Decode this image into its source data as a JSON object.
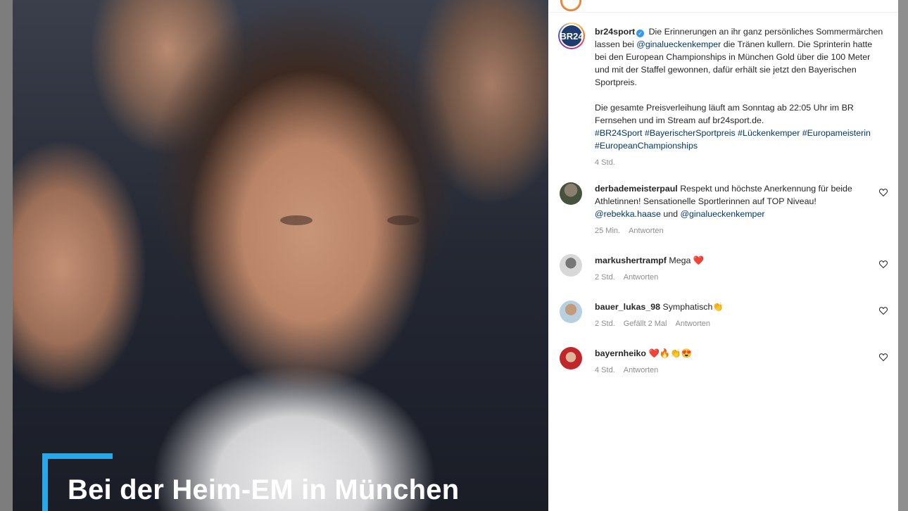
{
  "media": {
    "caption": "Bei der Heim-EM in München",
    "accent_color": "#28a8e8"
  },
  "post": {
    "avatar_logo": "BR24",
    "username": "br24sport",
    "verified_icon": "verified-badge-icon",
    "caption_parts": {
      "p1": "Die Erinnerungen an ihr ganz persönliches Sommermärchen lassen bei ",
      "mention": "@ginalueckenkemper",
      "p2": " die Tränen kullern. Die Sprinterin hatte bei den European Championships in München Gold über die 100 Meter und mit der Staffel gewonnen, dafür erhält sie jetzt den Bayerischen Sportpreis.",
      "p3": "Die gesamte Preisverleihung läuft am Sonntag ab 22:05 Uhr im BR Fernsehen und im Stream auf br24sport.de.",
      "tags": "#BR24Sport #BayerischerSportpreis #Lückenkemper #Europameisterin #EuropeanChampionships"
    },
    "time": "4 Std."
  },
  "comments": [
    {
      "username": "derbademeisterpaul",
      "text_before": "Respekt und höchste Anerkennung für beide Athletinnen! Sensationelle Sportlerinnen auf TOP Niveau! ",
      "mention1": "@rebekka.haase",
      "and": " und ",
      "mention2": "@ginalueckenkemper",
      "time": "25 Min.",
      "reply": "Antworten"
    },
    {
      "username": "markushertrampf",
      "text": "Mega ❤️",
      "time": "2 Std.",
      "reply": "Antworten"
    },
    {
      "username": "bauer_lukas_98",
      "text": "Symphatisch👏",
      "time": "2 Std.",
      "likes": "Gefällt 2 Mal",
      "reply": "Antworten"
    },
    {
      "username": "bayernheiko",
      "text": "❤️🔥👏😍",
      "time": "4 Std.",
      "reply": "Antworten"
    }
  ]
}
